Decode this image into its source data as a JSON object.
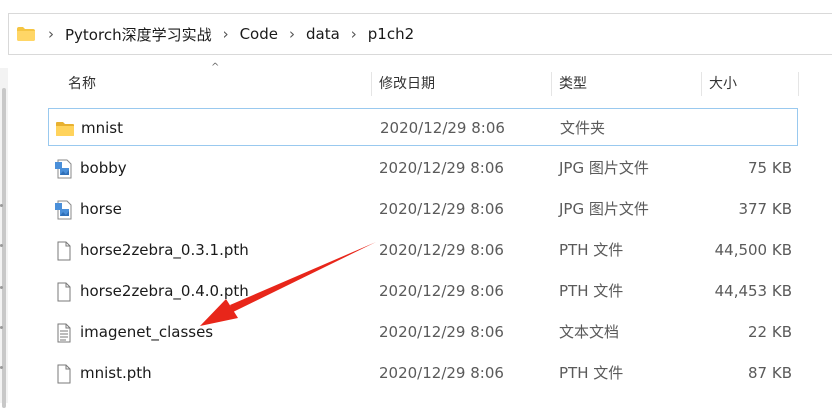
{
  "address": {
    "crumbs": [
      "Pytorch深度学习实战",
      "Code",
      "data",
      "p1ch2"
    ]
  },
  "columns": {
    "name": "名称",
    "date": "修改日期",
    "type": "类型",
    "size": "大小"
  },
  "files": [
    {
      "name": "mnist",
      "date": "2020/12/29 8:06",
      "type": "文件夹",
      "size": "",
      "icon": "folder-icon"
    },
    {
      "name": "bobby",
      "date": "2020/12/29 8:06",
      "type": "JPG 图片文件",
      "size": "75 KB",
      "icon": "image-file-icon"
    },
    {
      "name": "horse",
      "date": "2020/12/29 8:06",
      "type": "JPG 图片文件",
      "size": "377 KB",
      "icon": "image-file-icon"
    },
    {
      "name": "horse2zebra_0.3.1.pth",
      "date": "2020/12/29 8:06",
      "type": "PTH 文件",
      "size": "44,500 KB",
      "icon": "blank-file-icon"
    },
    {
      "name": "horse2zebra_0.4.0.pth",
      "date": "2020/12/29 8:06",
      "type": "PTH 文件",
      "size": "44,453 KB",
      "icon": "blank-file-icon"
    },
    {
      "name": "imagenet_classes",
      "date": "2020/12/29 8:06",
      "type": "文本文档",
      "size": "22 KB",
      "icon": "text-file-icon"
    },
    {
      "name": "mnist.pth",
      "date": "2020/12/29 8:06",
      "type": "PTH 文件",
      "size": "87 KB",
      "icon": "blank-file-icon"
    }
  ],
  "colors": {
    "folder": "#f5c542",
    "selection_border": "#99c9ef",
    "annotation_arrow": "#e8261a"
  }
}
